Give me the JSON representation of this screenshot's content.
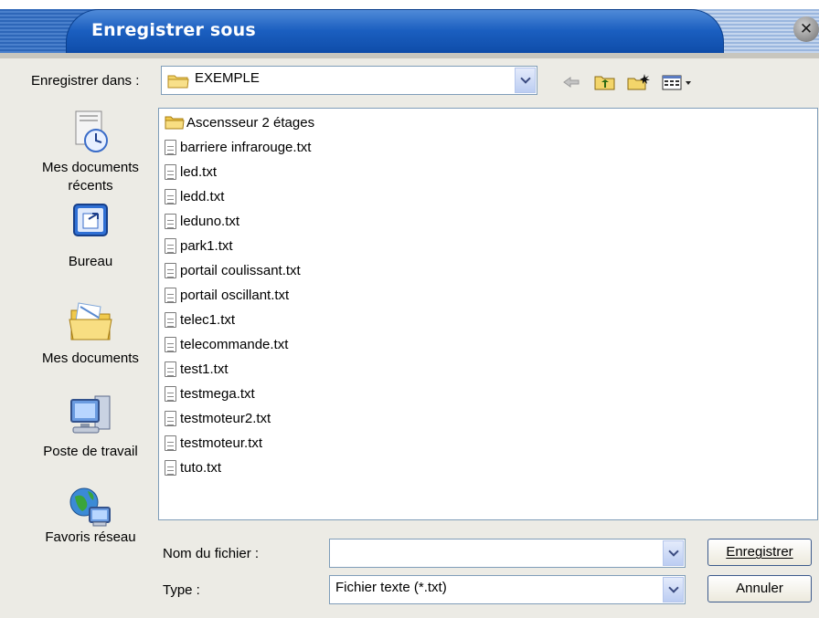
{
  "window": {
    "title": "Enregistrer sous",
    "close_glyph": "✕"
  },
  "save_in": {
    "label": "Enregistrer dans :",
    "value": "EXEMPLE"
  },
  "toolbar_icons": [
    "back-arrow-icon",
    "up-folder-icon",
    "new-folder-icon",
    "view-menu-icon"
  ],
  "places": [
    {
      "id": "recent",
      "label": "Mes documents récents",
      "icon": "recent-documents-icon"
    },
    {
      "id": "desktop",
      "label": "Bureau",
      "icon": "desktop-icon"
    },
    {
      "id": "mydocs",
      "label": "Mes documents",
      "icon": "my-documents-icon"
    },
    {
      "id": "computer",
      "label": "Poste de travail",
      "icon": "my-computer-icon"
    },
    {
      "id": "network",
      "label": "Favoris réseau",
      "icon": "network-places-icon"
    }
  ],
  "files": [
    {
      "name": "Ascensseur 2 étages",
      "kind": "folder"
    },
    {
      "name": "barriere infrarouge.txt",
      "kind": "txt"
    },
    {
      "name": "led.txt",
      "kind": "txt"
    },
    {
      "name": "ledd.txt",
      "kind": "txt"
    },
    {
      "name": "leduno.txt",
      "kind": "txt"
    },
    {
      "name": "park1.txt",
      "kind": "txt"
    },
    {
      "name": "portail coulissant.txt",
      "kind": "txt"
    },
    {
      "name": "portail oscillant.txt",
      "kind": "txt"
    },
    {
      "name": "telec1.txt",
      "kind": "txt"
    },
    {
      "name": "telecommande.txt",
      "kind": "txt"
    },
    {
      "name": "test1.txt",
      "kind": "txt"
    },
    {
      "name": "testmega.txt",
      "kind": "txt"
    },
    {
      "name": "testmoteur2.txt",
      "kind": "txt"
    },
    {
      "name": "testmoteur.txt",
      "kind": "txt"
    },
    {
      "name": "tuto.txt",
      "kind": "txt"
    }
  ],
  "filename": {
    "label": "Nom du fichier :",
    "value": ""
  },
  "filetype": {
    "label": "Type :",
    "value": "Fichier texte (*.txt)"
  },
  "buttons": {
    "save_label": "Enregistrer",
    "cancel_label": "Annuler"
  },
  "colors": {
    "title_blue": "#1b5fc0",
    "dialog_bg": "#ecebe5",
    "border_blue": "#7f9db9"
  }
}
